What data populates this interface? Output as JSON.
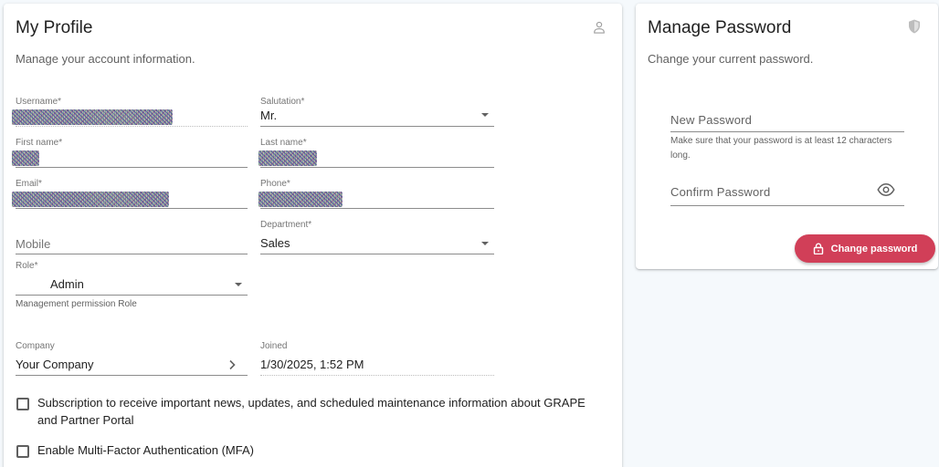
{
  "profile": {
    "title": "My Profile",
    "subtitle": "Manage your account information.",
    "header_icon": "person-icon",
    "fields": {
      "username": {
        "label": "Username*",
        "value": "",
        "redacted": true
      },
      "salutation": {
        "label": "Salutation*",
        "value": "Mr."
      },
      "first_name": {
        "label": "First name*",
        "value": "",
        "redacted": true
      },
      "last_name": {
        "label": "Last name*",
        "value": "",
        "redacted": true
      },
      "email": {
        "label": "Email*",
        "value": "",
        "redacted": true
      },
      "phone": {
        "label": "Phone*",
        "value": "",
        "redacted": true
      },
      "mobile": {
        "placeholder": "Mobile",
        "value": ""
      },
      "department": {
        "label": "Department*",
        "value": "Sales"
      },
      "role": {
        "label": "Role*",
        "value": "Admin",
        "helper": "Management permission Role"
      },
      "company": {
        "label": "Company",
        "value": "Your Company"
      },
      "joined": {
        "label": "Joined",
        "value": "1/30/2025, 1:52 PM"
      }
    },
    "checkboxes": {
      "subscription": {
        "label": "Subscription to receive important news, updates, and scheduled maintenance information about GRAPE and Partner Portal",
        "checked": false
      },
      "mfa": {
        "label": "Enable Multi-Factor Authentication (MFA)",
        "checked": false
      }
    }
  },
  "password": {
    "title": "Manage Password",
    "subtitle": "Change your current password.",
    "header_icon": "shield-icon",
    "new_password": {
      "placeholder": "New Password",
      "helper": "Make sure that your password is at least 12 characters long."
    },
    "confirm_password": {
      "placeholder": "Confirm Password"
    },
    "button_label": "Change password",
    "button_color": "#d13f58"
  }
}
